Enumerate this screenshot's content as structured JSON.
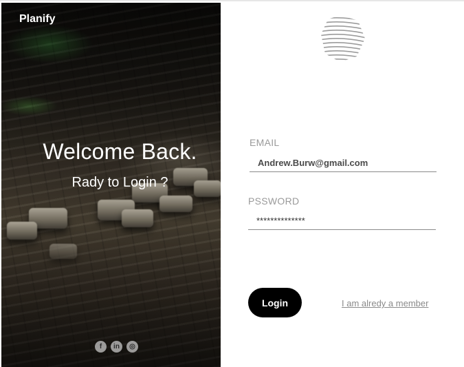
{
  "brand": {
    "name": "Planify"
  },
  "hero": {
    "title": "Welcome Back.",
    "subtitle": "Rady to Login ?"
  },
  "social": [
    {
      "icon": "facebook-icon",
      "glyph": "f"
    },
    {
      "icon": "linkedin-icon",
      "glyph": "in"
    },
    {
      "icon": "instagram-icon",
      "glyph": "◎"
    }
  ],
  "form": {
    "email_label": "EMAIL",
    "email_value": "Andrew.Burw@gmail.com",
    "password_label": "PSSWORD",
    "password_value": "**************",
    "login_label": "Login",
    "member_link": "I am alredy a member"
  },
  "colors": {
    "button_bg": "#000000",
    "label": "#9a9a9a",
    "link": "#8a8a8a"
  }
}
